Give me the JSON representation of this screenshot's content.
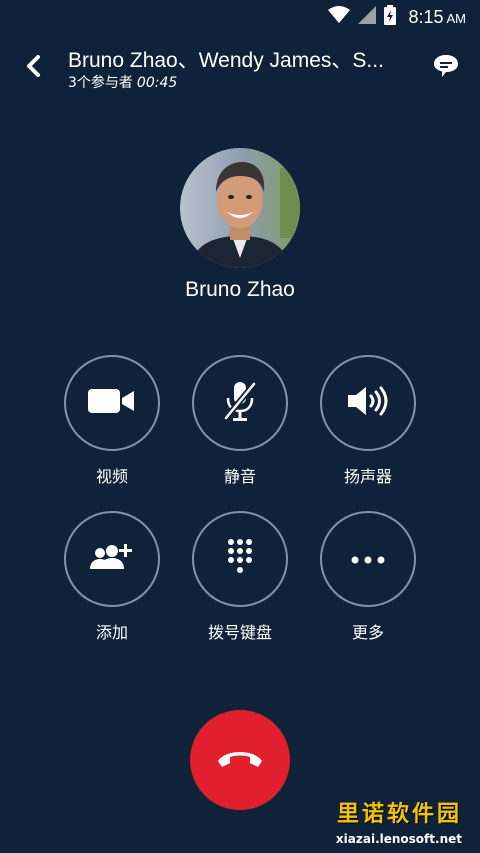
{
  "status_bar": {
    "time": "8:15",
    "ampm": "AM",
    "icons": [
      "wifi-icon",
      "signal-icon",
      "battery-charging-icon"
    ]
  },
  "header": {
    "title": "Bruno Zhao、Wendy James、S...",
    "participants": "3个参与者",
    "timer": "00:45",
    "icons": [
      "back-arrow-icon",
      "chat-bubble-icon"
    ]
  },
  "caller": {
    "name": "Bruno Zhao"
  },
  "actions": [
    {
      "label": "视频",
      "icon": "video-camera-icon"
    },
    {
      "label": "静音",
      "icon": "mic-muted-icon"
    },
    {
      "label": "扬声器",
      "icon": "speaker-icon"
    },
    {
      "label": "添加",
      "icon": "add-people-icon"
    },
    {
      "label": "拨号键盘",
      "icon": "dialpad-icon"
    },
    {
      "label": "更多",
      "icon": "more-icon"
    }
  ],
  "end_call": {
    "icon": "hang-up-icon",
    "color": "#e2202d"
  },
  "watermark": {
    "title": "里诺软件园",
    "url": "xiazai.lenosoft.net"
  },
  "colors": {
    "background": "#10223a",
    "button_border": "#8592a3",
    "end_call": "#e2202d"
  }
}
